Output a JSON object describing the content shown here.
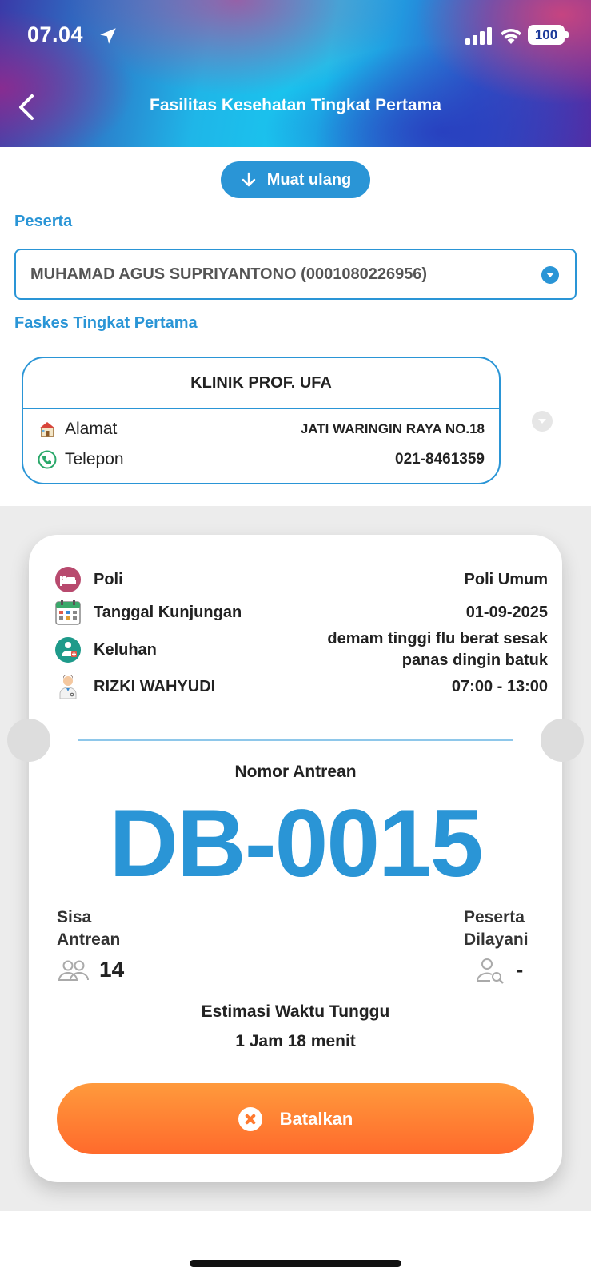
{
  "status_bar": {
    "time": "07.04",
    "battery": "100",
    "icons": [
      "location-arrow-icon",
      "signal-icon",
      "wifi-icon",
      "battery-icon"
    ]
  },
  "header": {
    "title": "Fasilitas Kesehatan Tingkat Pertama",
    "back_icon": "chevron-left-icon"
  },
  "reload": {
    "label": "Muat ulang",
    "icon": "arrow-down-icon"
  },
  "peserta": {
    "label": "Peserta",
    "selected": "MUHAMAD AGUS SUPRIYANTONO (0001080226956)"
  },
  "faskes": {
    "label": "Faskes Tingkat Pertama",
    "name": "KLINIK PROF. UFA",
    "alamat_label": "Alamat",
    "alamat_value": "JATI WARINGIN RAYA NO.18",
    "telepon_label": "Telepon",
    "telepon_value": "021-8461359"
  },
  "ticket": {
    "poli_label": "Poli",
    "poli_value": "Poli Umum",
    "tanggal_label": "Tanggal Kunjungan",
    "tanggal_value": "01-09-2025",
    "keluhan_label": "Keluhan",
    "keluhan_value": "demam tinggi flu berat sesak panas dingin batuk",
    "dokter_label": "RIZKI WAHYUDI",
    "dokter_value": "07:00 - 13:00",
    "queue_label": "Nomor Antrean",
    "queue_number": "DB-0015",
    "sisa_label_1": "Sisa",
    "sisa_label_2": "Antrean",
    "sisa_value": "14",
    "dilayani_label_1": "Peserta",
    "dilayani_label_2": "Dilayani",
    "dilayani_value": "-",
    "estimasi_label": "Estimasi Waktu Tunggu",
    "estimasi_value": "1 Jam 18 menit",
    "cancel_label": "Batalkan"
  },
  "colors": {
    "primary_blue": "#2a95d6",
    "cancel_orange": "#ff7a30"
  }
}
